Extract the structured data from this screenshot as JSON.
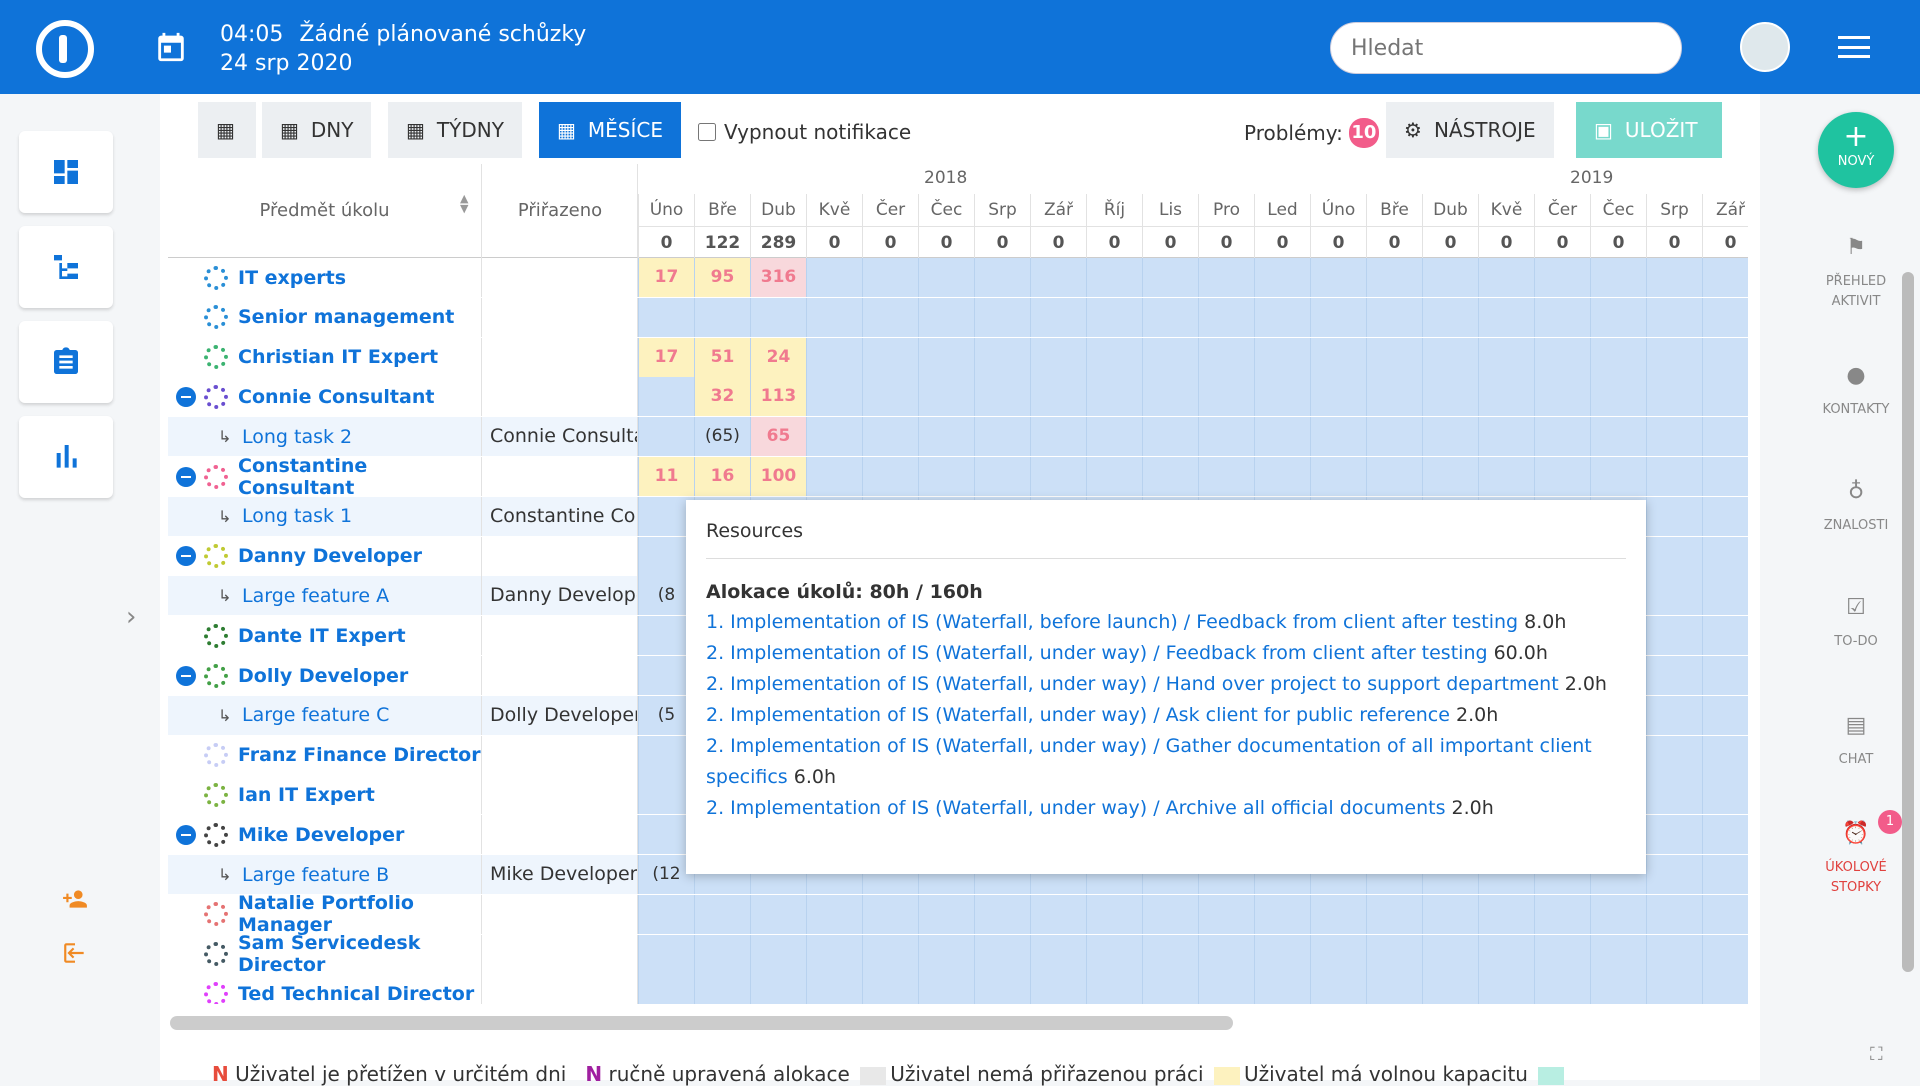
{
  "header": {
    "time": "04:05",
    "meetings": "Žádné plánované schůzky",
    "date": "24 srp 2020",
    "search_placeholder": "Hledat"
  },
  "toolbar": {
    "days": "DNY",
    "weeks": "TÝDNY",
    "months": "MĚSÍCE",
    "notify": "Vypnout notifikace",
    "problems_label": "Problémy:",
    "problems_count": "10",
    "tools": "NÁSTROJE",
    "save": "ULOŽIT"
  },
  "grid": {
    "col_subject": "Předmět úkolu",
    "col_assigned": "Přiřazeno",
    "years": [
      "2018",
      "2019"
    ],
    "months": [
      "Úno",
      "Bře",
      "Dub",
      "Kvě",
      "Čer",
      "Čec",
      "Srp",
      "Zář",
      "Říj",
      "Lis",
      "Pro",
      "Led",
      "Úno",
      "Bře",
      "Dub",
      "Kvě",
      "Čer",
      "Čec",
      "Srp",
      "Zář"
    ],
    "month_totals": [
      "0",
      "122",
      "289",
      "0",
      "0",
      "0",
      "0",
      "0",
      "0",
      "0",
      "0",
      "0",
      "0",
      "0",
      "0",
      "0",
      "0",
      "0",
      "0",
      "0"
    ],
    "rows": [
      {
        "name": "IT experts",
        "type": "group",
        "icon": "#2a8fd6",
        "cells": [
          [
            "17",
            "y"
          ],
          [
            "95",
            "y"
          ],
          [
            "316",
            "p"
          ]
        ]
      },
      {
        "name": "Senior management",
        "type": "group",
        "icon": "#2a8fd6",
        "cells": []
      },
      {
        "name": "Christian IT Expert",
        "type": "user",
        "icon": "#3cb371",
        "cells": [
          [
            "17",
            "y"
          ],
          [
            "51",
            "y"
          ],
          [
            "24",
            "y"
          ]
        ]
      },
      {
        "name": "Connie Consultant",
        "type": "user",
        "icon": "#6a4fd0",
        "collapse": true,
        "cells": [
          [
            "",
            ""
          ],
          [
            "32",
            "y"
          ],
          [
            "113",
            "y"
          ]
        ]
      },
      {
        "name": "Long task 2",
        "type": "task",
        "assigned": "Connie Consultant",
        "cells": [
          [
            "",
            ""
          ],
          [
            "(65)",
            "t"
          ],
          [
            "65",
            "p"
          ]
        ]
      },
      {
        "name": "Constantine Consultant",
        "type": "user",
        "icon": "#f06292",
        "collapse": true,
        "cells": [
          [
            "11",
            "y"
          ],
          [
            "16",
            "y"
          ],
          [
            "100",
            "y"
          ]
        ]
      },
      {
        "name": "Long task 1",
        "type": "task",
        "assigned": "Constantine Consultant",
        "cells": []
      },
      {
        "name": "Danny Developer",
        "type": "user",
        "icon": "#c0ca33",
        "collapse": true,
        "cells": []
      },
      {
        "name": "Large feature A",
        "type": "task",
        "assigned": "Danny Developer",
        "cells": [
          [
            "(8",
            "t"
          ]
        ]
      },
      {
        "name": "Dante IT Expert",
        "type": "user",
        "icon": "#2e7d32",
        "cells": []
      },
      {
        "name": "Dolly Developer",
        "type": "user",
        "icon": "#43a047",
        "collapse": true,
        "cells": []
      },
      {
        "name": "Large feature C",
        "type": "task",
        "assigned": "Dolly Developer",
        "cells": [
          [
            "(5",
            "t"
          ]
        ]
      },
      {
        "name": "Franz Finance Director",
        "type": "user",
        "icon": "#c7cdf5",
        "cells": []
      },
      {
        "name": "Ian IT Expert",
        "type": "user",
        "icon": "#7cb342",
        "cells": []
      },
      {
        "name": "Mike Developer",
        "type": "user",
        "icon": "#444",
        "collapse": true,
        "cells": []
      },
      {
        "name": "Large feature B",
        "type": "task",
        "assigned": "Mike Developer",
        "cells": [
          [
            "(12",
            "t"
          ]
        ]
      },
      {
        "name": "Natalie Portfolio Manager",
        "type": "user",
        "icon": "#e57373",
        "cells": []
      },
      {
        "name": "Sam Servicedesk Director",
        "type": "user",
        "icon": "#455a64",
        "cells": []
      },
      {
        "name": "Ted Technical Director",
        "type": "user",
        "icon": "#e040fb",
        "cells": []
      }
    ]
  },
  "tooltip": {
    "title": "Resources",
    "allocation": "Alokace úkolů: 80h / 160h",
    "lines": [
      {
        "link": "1. Implementation of IS (Waterfall, before launch) / Feedback from client after testing",
        "hours": "8.0h"
      },
      {
        "link": "2. Implementation of IS (Waterfall, under way) / Feedback from client after testing",
        "hours": "60.0h"
      },
      {
        "link": "2. Implementation of IS (Waterfall, under way) / Hand over project to support department",
        "hours": "2.0h"
      },
      {
        "link": "2. Implementation of IS (Waterfall, under way) / Ask client for public reference",
        "hours": "2.0h"
      },
      {
        "link": "2. Implementation of IS (Waterfall, under way) / Gather documentation of all important client specifics",
        "hours": "6.0h"
      },
      {
        "link": "2. Implementation of IS (Waterfall, under way) / Archive all official documents",
        "hours": "2.0h"
      }
    ]
  },
  "legend": {
    "n1": "N",
    "t1": "Uživatel je přetížen v určitém dni",
    "n2": "N",
    "t2": "ručně upravená alokace",
    "t3": "Uživatel nemá přiřazenou práci",
    "t4": "Uživatel má volnou kapacitu"
  },
  "right": {
    "new": "NOVÝ",
    "activity": "PŘEHLED AKTIVIT",
    "contacts": "KONTAKTY",
    "knowledge": "ZNALOSTI",
    "todo": "TO-DO",
    "chat": "CHAT",
    "timers": "ÚKOLOVÉ STOPKY",
    "timers_badge": "1"
  },
  "colors": {
    "brand": "#0f73d9",
    "accent": "#1fc3a0",
    "problem": "#f25c8a"
  }
}
